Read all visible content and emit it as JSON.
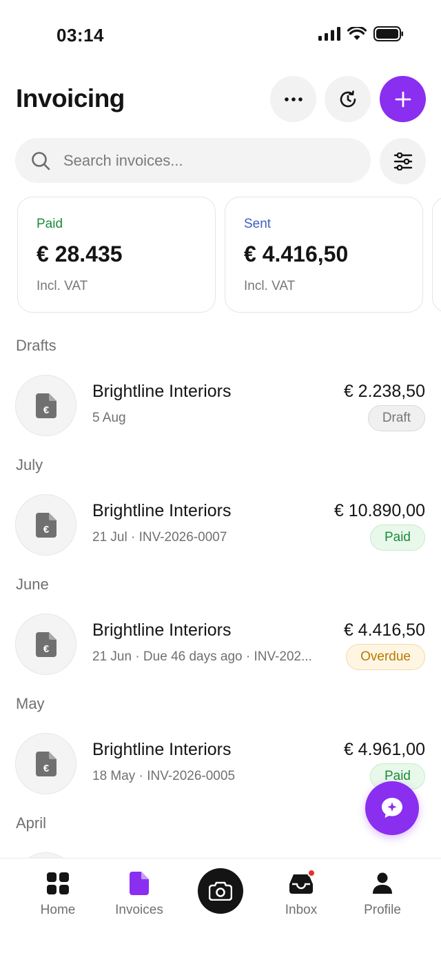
{
  "status_bar": {
    "time": "03:14"
  },
  "header": {
    "title": "Invoicing"
  },
  "search": {
    "placeholder": "Search invoices..."
  },
  "summary_cards": [
    {
      "label": "Paid",
      "amount": "€ 28.435",
      "note": "Incl. VAT",
      "label_color": "#1c8a3a"
    },
    {
      "label": "Sent",
      "amount": "€ 4.416,50",
      "note": "Incl. VAT",
      "label_color": "#3d5fc4"
    }
  ],
  "sections": [
    {
      "title": "Drafts",
      "invoices": [
        {
          "client": "Brightline Interiors",
          "meta": "5 Aug",
          "amount": "€ 2.238,50",
          "status": "Draft"
        }
      ]
    },
    {
      "title": "July",
      "invoices": [
        {
          "client": "Brightline Interiors",
          "meta": "21 Jul · INV-2026-0007",
          "amount": "€ 10.890,00",
          "status": "Paid"
        }
      ]
    },
    {
      "title": "June",
      "invoices": [
        {
          "client": "Brightline Interiors",
          "meta": "21 Jun · Due 46 days ago · INV-202...",
          "amount": "€ 4.416,50",
          "status": "Overdue"
        }
      ]
    },
    {
      "title": "May",
      "invoices": [
        {
          "client": "Brightline Interiors",
          "meta": "18 May · INV-2026-0005",
          "amount": "€ 4.961,00",
          "status": "Paid"
        }
      ]
    },
    {
      "title": "April",
      "invoices": []
    }
  ],
  "bottom_nav": {
    "items": [
      {
        "label": "Home",
        "icon": "grid-icon"
      },
      {
        "label": "Invoices",
        "icon": "document-icon",
        "active": true
      },
      {
        "label": "Inbox",
        "icon": "inbox-icon",
        "has_notification": true
      },
      {
        "label": "Profile",
        "icon": "person-icon"
      }
    ],
    "camera_icon": "camera-icon"
  },
  "colors": {
    "accent": "#8a2ef0",
    "paid": "#1c8a3a",
    "overdue": "#b67a00",
    "notification": "#e5322d"
  }
}
